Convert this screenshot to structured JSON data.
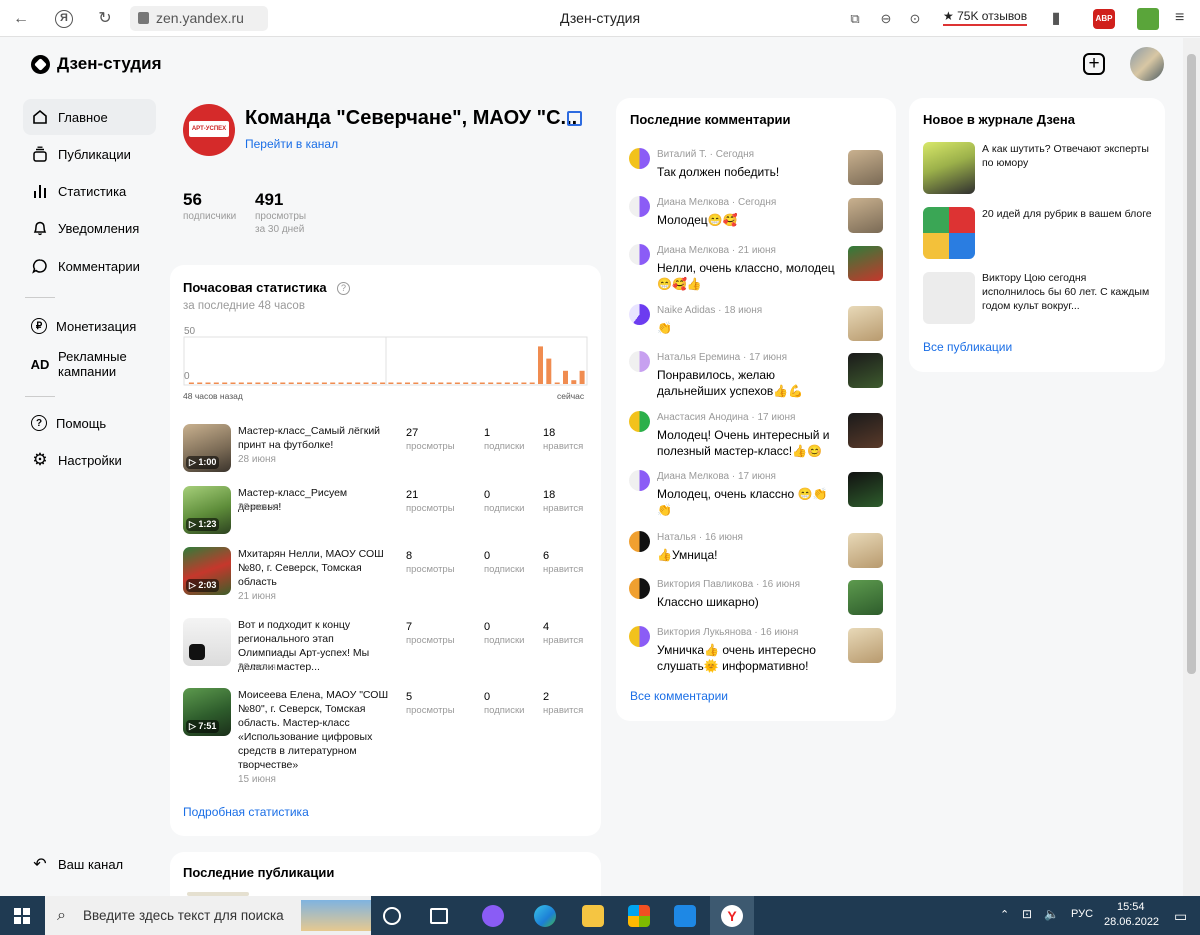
{
  "browser": {
    "url": "zen.yandex.ru",
    "title": "Дзен-студия",
    "reviews": "75K отзывов",
    "abp": "ABP"
  },
  "app": {
    "logo": "Дзен-студия",
    "add_symbol": "+"
  },
  "sidebar": {
    "items": [
      {
        "label": "Главное",
        "icon": "home-icon"
      },
      {
        "label": "Публикации",
        "icon": "publications-icon"
      },
      {
        "label": "Статистика",
        "icon": "stats-icon"
      },
      {
        "label": "Уведомления",
        "icon": "bell-icon"
      },
      {
        "label": "Комментарии",
        "icon": "comment-icon"
      },
      {
        "label": "Монетизация",
        "icon": "ruble-icon"
      },
      {
        "label": "Рекламные кампании",
        "icon": "ad-icon",
        "icon_text": "AD"
      },
      {
        "label": "Помощь",
        "icon": "help-icon"
      },
      {
        "label": "Настройки",
        "icon": "gear-icon"
      },
      {
        "label": "Ваш канал",
        "icon": "back-arrow-icon"
      }
    ]
  },
  "channel": {
    "name": "Команда \"Северчане\", МАОУ \"С...",
    "goto": "Перейти в канал",
    "logo_text": "АРТ-УСПЕХ",
    "subscribers": "56",
    "subscribers_label": "подписчики",
    "views": "491",
    "views_label": "просмотры",
    "views_period": "за 30 дней"
  },
  "hourly": {
    "title": "Почасовая статистика",
    "subtitle": "за последние 48 часов",
    "help": "?",
    "start_label": "48 часов назад",
    "end_label": "сейчас",
    "details_link": "Подробная статистика"
  },
  "chart_data": {
    "type": "bar",
    "title": "",
    "ylim": [
      0,
      50
    ],
    "yticks": [
      0,
      50
    ],
    "start_label": "48 часов назад",
    "end_label": "сейчас",
    "values": [
      1,
      1,
      1,
      1,
      1,
      1,
      1,
      1,
      1,
      1,
      1,
      1,
      1,
      1,
      1,
      1,
      1,
      1,
      1,
      1,
      1,
      1,
      1,
      1,
      1,
      1,
      1,
      1,
      1,
      1,
      1,
      1,
      1,
      1,
      1,
      1,
      1,
      1,
      1,
      1,
      1,
      1,
      40,
      27,
      1,
      14,
      4,
      14
    ],
    "color": "#f08c50"
  },
  "publications": [
    {
      "title": "Мастер-класс_Самый лёгкий принт на футболке!",
      "date": "28 июня",
      "duration": "1:00",
      "views": "27",
      "subs": "1",
      "likes": "18"
    },
    {
      "title": "Мастер-класс_Рисуем деревья!",
      "date": "28 июня",
      "duration": "1:23",
      "views": "21",
      "subs": "0",
      "likes": "18"
    },
    {
      "title": "Мхитарян Нелли, МАОУ СОШ №80, г. Северск, Томская область",
      "date": "21 июня",
      "duration": "2:03",
      "views": "8",
      "subs": "0",
      "likes": "6"
    },
    {
      "title": "Вот и подходит к концу регионального этап Олимпиады Арт-успех! Мы делали мастер...",
      "date": "28 июня",
      "duration": "",
      "views": "7",
      "subs": "0",
      "likes": "4"
    },
    {
      "title": "Моисеева Елена, МАОУ \"СОШ №80\", г. Северск, Томская область. Мастер-класс «Использование цифровых средств в литературном творчестве»",
      "date": "15 июня",
      "duration": "7:51",
      "views": "5",
      "subs": "0",
      "likes": "2"
    }
  ],
  "pub_labels": {
    "views": "просмотры",
    "subs": "подписки",
    "likes": "нравится"
  },
  "latest_pubs": {
    "title": "Последние публикации"
  },
  "comments": {
    "title": "Последние комментарии",
    "all_link": "Все комментарии",
    "items": [
      {
        "author": "Виталий Т.",
        "date": "Сегодня",
        "text": "Так должен победить!"
      },
      {
        "author": "Диана Мелкова",
        "date": "Сегодня",
        "text": "Молодец😁🥰"
      },
      {
        "author": "Диана Мелкова",
        "date": "21 июня",
        "text": "Нелли, очень классно, молодец😁🥰👍"
      },
      {
        "author": "Naike Adidas",
        "date": "18 июня",
        "text": "👏"
      },
      {
        "author": "Наталья Еремина",
        "date": "17 июня",
        "text": "Понравилось, желаю дальнейших успехов👍💪"
      },
      {
        "author": "Анастасия Анодина",
        "date": "17 июня",
        "text": "Молодец! Очень интересный и полезный мастер-класс!👍😊"
      },
      {
        "author": "Диана Мелкова",
        "date": "17 июня",
        "text": "Молодец, очень классно 😁👏👏"
      },
      {
        "author": "Наталья",
        "date": "16 июня",
        "text": "👍Умница!"
      },
      {
        "author": "Виктория Павликова",
        "date": "16 июня",
        "text": "Классно шикарно)"
      },
      {
        "author": "Виктория Лукьянова",
        "date": "16 июня",
        "text": "Умничка👍 очень интересно слушать🌞 информативно!"
      }
    ]
  },
  "journal": {
    "title": "Новое в журнале Дзена",
    "all_link": "Все публикации",
    "items": [
      {
        "title": "А как шутить? Отвечают эксперты по юмору"
      },
      {
        "title": "20 идей для рубрик в вашем блоге"
      },
      {
        "title": "Виктору Цою сегодня исполнилось бы 60 лет. С каждым годом культ вокруг..."
      }
    ]
  },
  "taskbar": {
    "search_placeholder": "Введите здесь текст для поиска",
    "lang": "РУС",
    "time": "15:54",
    "date": "28.06.2022"
  }
}
